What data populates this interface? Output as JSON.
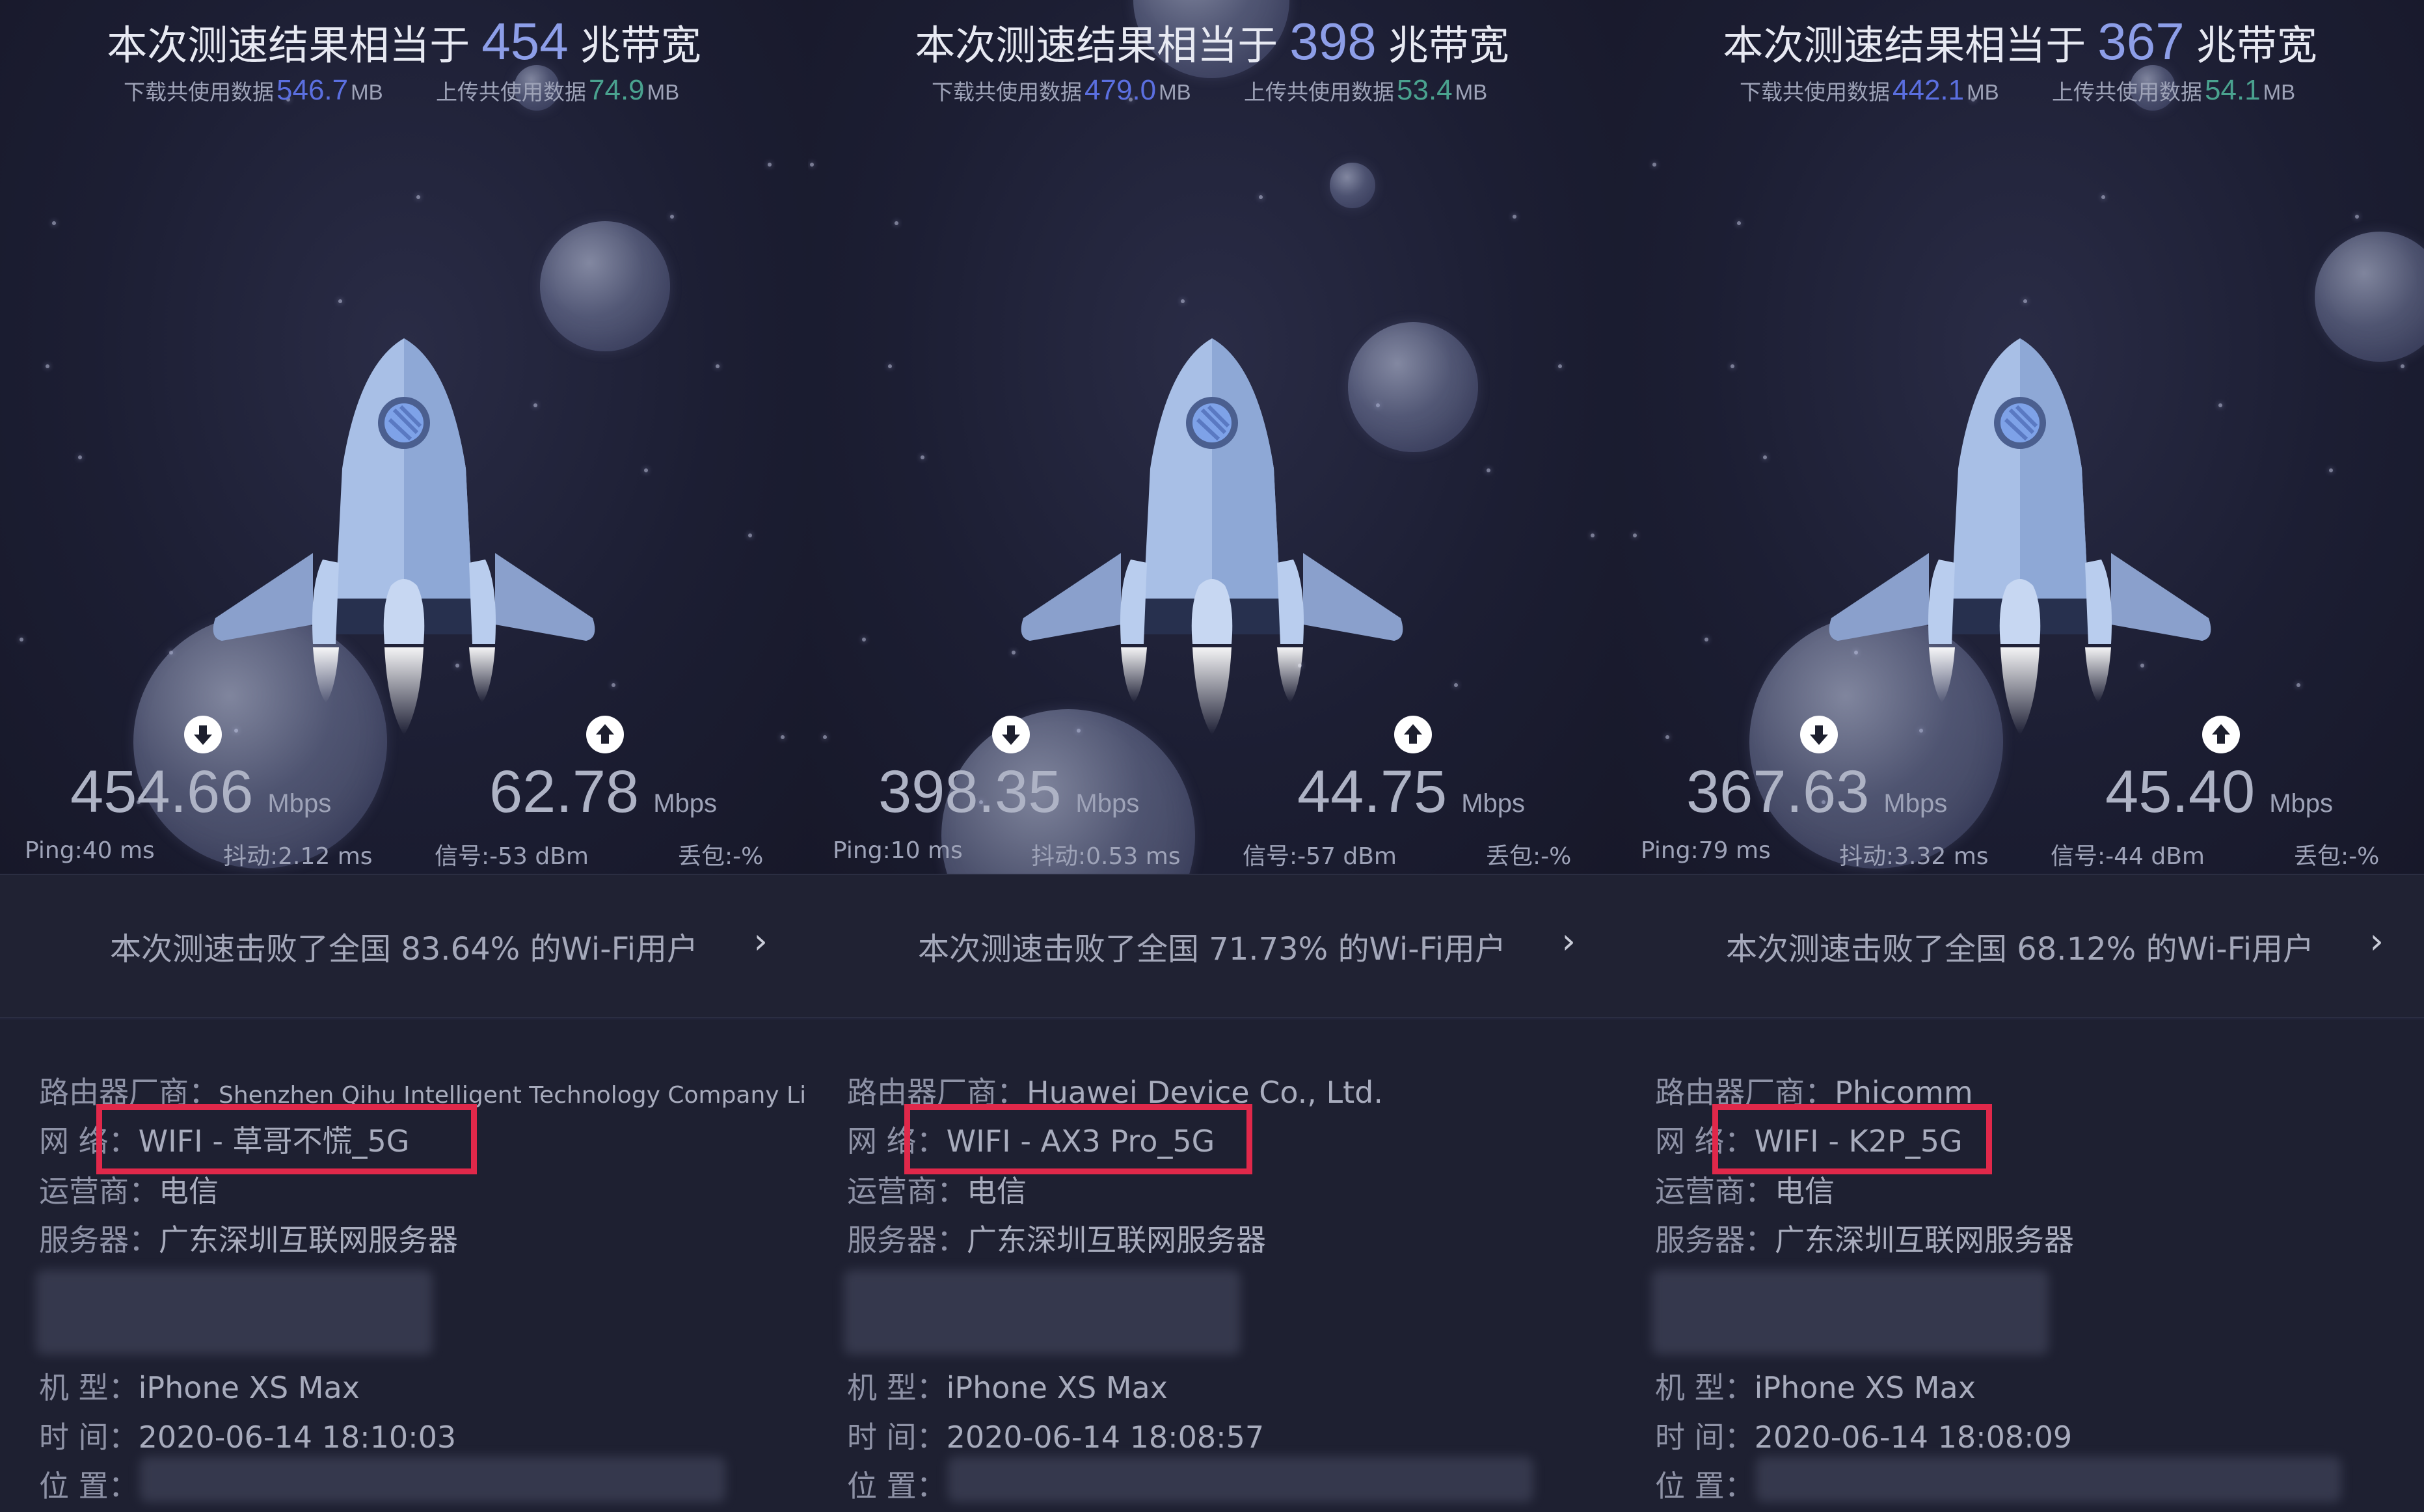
{
  "labels": {
    "title_prefix": "本次测速结果相当于",
    "title_suffix": "兆带宽",
    "download_used": "下载共使用数据",
    "upload_used": "上传共使用数据",
    "mb": "MB",
    "mbps": "Mbps",
    "router_vendor": "路由器厂商：",
    "network": "网 络：",
    "carrier": "运营商：",
    "server": "服务器：",
    "model": "机 型：",
    "time": "时 间：",
    "location": "位 置："
  },
  "panels": [
    {
      "bandwidth": "454",
      "download_mb": "546.7",
      "upload_mb": "74.9",
      "download_speed": "454.66",
      "upload_speed": "62.78",
      "ping": "Ping:40 ms",
      "jitter": "抖动:2.12 ms",
      "signal": "信号:-53 dBm",
      "loss": "丢包:-%",
      "beat_text": "本次测速击败了全国 83.64% 的Wi-Fi用户",
      "router_vendor": "Shenzhen Qihu Intelligent Technology Company Limited",
      "network": "WIFI - 草哥不慌_5G",
      "carrier": "电信",
      "server": "广东深圳互联网服务器",
      "model": "iPhone XS Max",
      "time": "2020-06-14 18:10:03"
    },
    {
      "bandwidth": "398",
      "download_mb": "479.0",
      "upload_mb": "53.4",
      "download_speed": "398.35",
      "upload_speed": "44.75",
      "ping": "Ping:10 ms",
      "jitter": "抖动:0.53 ms",
      "signal": "信号:-57 dBm",
      "loss": "丢包:-%",
      "beat_text": "本次测速击败了全国 71.73% 的Wi-Fi用户",
      "router_vendor": "Huawei Device Co., Ltd.",
      "network": "WIFI - AX3 Pro_5G",
      "carrier": "电信",
      "server": "广东深圳互联网服务器",
      "model": "iPhone XS Max",
      "time": "2020-06-14 18:08:57"
    },
    {
      "bandwidth": "367",
      "download_mb": "442.1",
      "upload_mb": "54.1",
      "download_speed": "367.63",
      "upload_speed": "45.40",
      "ping": "Ping:79 ms",
      "jitter": "抖动:3.32 ms",
      "signal": "信号:-44 dBm",
      "loss": "丢包:-%",
      "beat_text": "本次测速击败了全国 68.12% 的Wi-Fi用户",
      "router_vendor": "Phicomm",
      "network": "WIFI - K2P_5G",
      "carrier": "电信",
      "server": "广东深圳互联网服务器",
      "model": "iPhone XS Max",
      "time": "2020-06-14 18:08:09"
    }
  ],
  "colors": {
    "accent_blue": "#8d9ee8",
    "download_blue": "#5b6fe0",
    "upload_green": "#4aa28f",
    "highlight_red": "#e0284a",
    "background": "#1d1f2e"
  },
  "icons": [
    "download-arrow-icon",
    "upload-arrow-icon",
    "chevron-right-icon",
    "rocket-icon"
  ]
}
